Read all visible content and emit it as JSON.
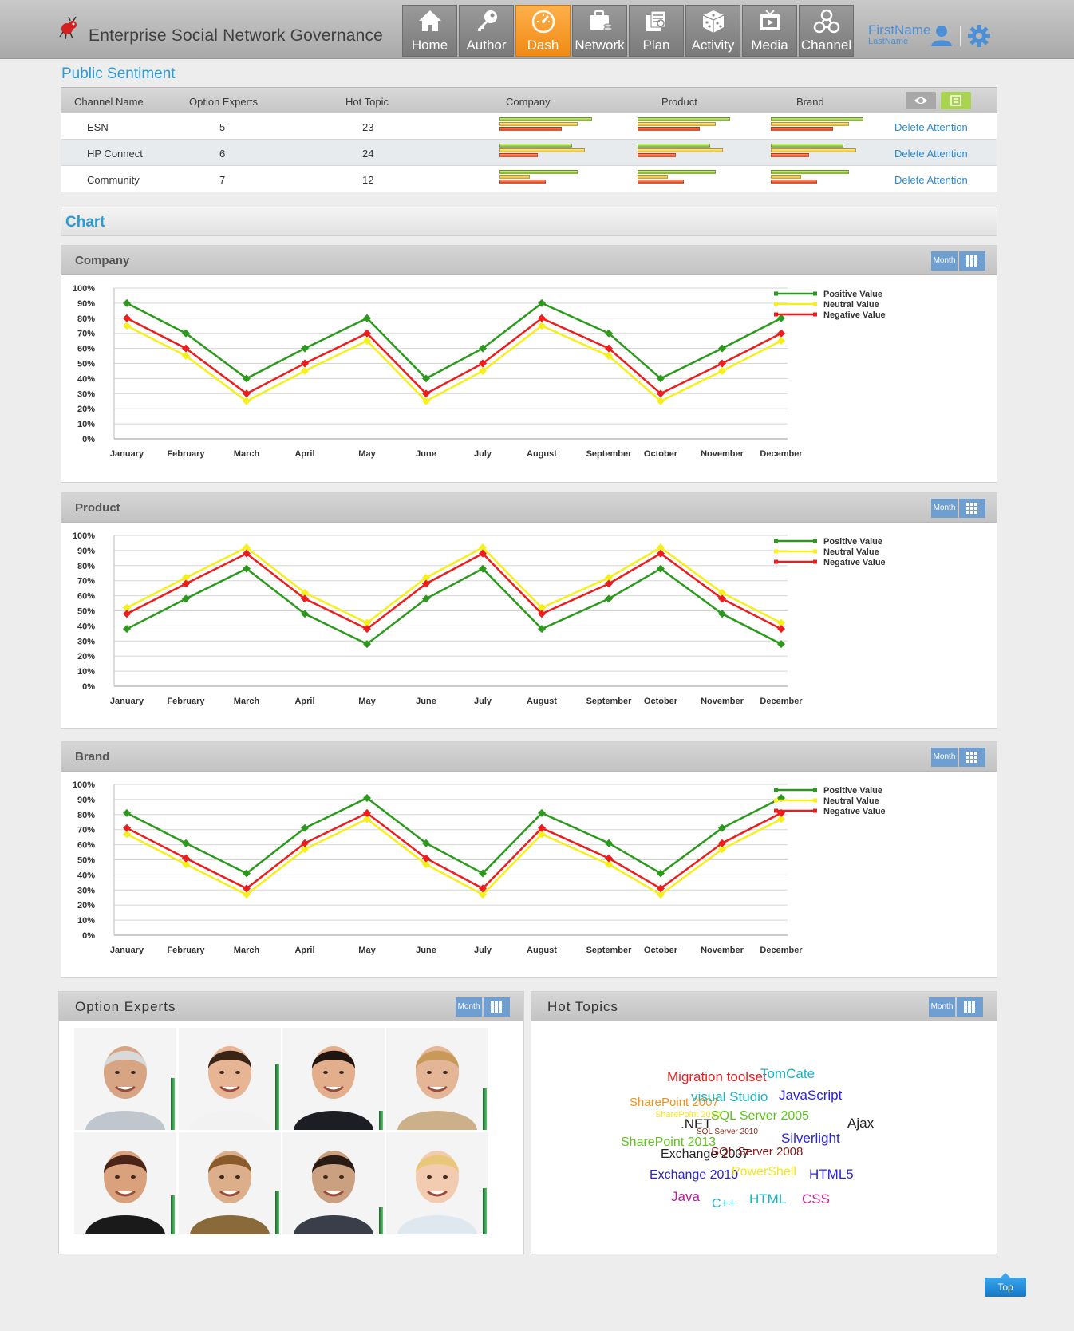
{
  "header": {
    "app_title": "Enterprise Social Network Governance",
    "nav": [
      {
        "label": "Home",
        "icon": "home-icon",
        "active": false
      },
      {
        "label": "Author",
        "icon": "key-icon",
        "active": false
      },
      {
        "label": "Dash",
        "icon": "dashboard-icon",
        "active": true
      },
      {
        "label": "Network",
        "icon": "briefcase-icon",
        "active": false
      },
      {
        "label": "Plan",
        "icon": "plan-icon",
        "active": false
      },
      {
        "label": "Activity",
        "icon": "dice-icon",
        "active": false
      },
      {
        "label": "Media",
        "icon": "tv-icon",
        "active": false
      },
      {
        "label": "Channel",
        "icon": "network-nodes-icon",
        "active": false
      }
    ],
    "user_first": "FirstName",
    "user_last": "LastName"
  },
  "public_sentiment": {
    "title": "Public Sentiment",
    "headers": {
      "channel": "Channel Name",
      "experts": "Option Experts",
      "topic": "Hot Topic",
      "company": "Company",
      "product": "Product",
      "brand": "Brand"
    },
    "rows": [
      {
        "channel": "ESN",
        "experts": "5",
        "topic": "23",
        "action": "Delete Attention",
        "company": [
          0.92,
          0.78,
          0.62
        ],
        "product": [
          0.92,
          0.78,
          0.62
        ],
        "brand": [
          0.92,
          0.78,
          0.62
        ]
      },
      {
        "channel": "HP Connect",
        "experts": "6",
        "topic": "24",
        "action": "Delete Attention",
        "company": [
          0.72,
          0.85,
          0.38
        ],
        "product": [
          0.72,
          0.85,
          0.38
        ],
        "brand": [
          0.72,
          0.85,
          0.38
        ]
      },
      {
        "channel": "Community",
        "experts": "7",
        "topic": "12",
        "action": "Delete Attention",
        "company": [
          0.78,
          0.3,
          0.46
        ],
        "product": [
          0.78,
          0.3,
          0.46
        ],
        "brand": [
          0.78,
          0.3,
          0.46
        ]
      }
    ]
  },
  "chart_section_title": "Chart",
  "month_label": "Month",
  "chart_data": [
    {
      "type": "line",
      "title": "Company",
      "categories": [
        "January",
        "February",
        "March",
        "April",
        "May",
        "June",
        "July",
        "August",
        "September",
        "October",
        "November",
        "December"
      ],
      "ylim": [
        0,
        100
      ],
      "yticks": [
        "0%",
        "10%",
        "20%",
        "30%",
        "40%",
        "50%",
        "60%",
        "70%",
        "80%",
        "90%",
        "100%"
      ],
      "legend_position": "top-right",
      "grid": true,
      "series": [
        {
          "name": "Positive Value",
          "color": "#2b9a1c",
          "values": [
            90,
            70,
            40,
            60,
            80,
            40,
            60,
            90,
            70,
            40,
            60,
            80
          ]
        },
        {
          "name": "Neutral Value",
          "color": "#f5f019",
          "values": [
            75,
            55,
            25,
            45,
            65,
            25,
            45,
            75,
            55,
            25,
            45,
            65
          ]
        },
        {
          "name": "Negative Value",
          "color": "#ee1c1c",
          "values": [
            80,
            60,
            30,
            50,
            70,
            30,
            50,
            80,
            60,
            30,
            50,
            70
          ]
        }
      ]
    },
    {
      "type": "line",
      "title": "Product",
      "categories": [
        "January",
        "February",
        "March",
        "April",
        "May",
        "June",
        "July",
        "August",
        "September",
        "October",
        "November",
        "December"
      ],
      "ylim": [
        0,
        100
      ],
      "yticks": [
        "0%",
        "10%",
        "20%",
        "30%",
        "40%",
        "50%",
        "60%",
        "70%",
        "80%",
        "90%",
        "100%"
      ],
      "legend_position": "top-right",
      "grid": true,
      "series": [
        {
          "name": "Positive Value",
          "color": "#2b9a1c",
          "values": [
            38,
            58,
            78,
            48,
            28,
            58,
            78,
            38,
            58,
            78,
            48,
            28
          ]
        },
        {
          "name": "Neutral Value",
          "color": "#f5f019",
          "values": [
            52,
            72,
            92,
            62,
            42,
            72,
            92,
            52,
            72,
            92,
            62,
            42
          ]
        },
        {
          "name": "Negative Value",
          "color": "#ee1c1c",
          "values": [
            48,
            68,
            88,
            58,
            38,
            68,
            88,
            48,
            68,
            88,
            58,
            38
          ]
        }
      ]
    },
    {
      "type": "line",
      "title": "Brand",
      "categories": [
        "January",
        "February",
        "March",
        "April",
        "May",
        "June",
        "July",
        "August",
        "September",
        "October",
        "November",
        "December"
      ],
      "ylim": [
        0,
        100
      ],
      "yticks": [
        "0%",
        "10%",
        "20%",
        "30%",
        "40%",
        "50%",
        "60%",
        "70%",
        "80%",
        "90%",
        "100%"
      ],
      "legend_position": "top-right",
      "grid": true,
      "series": [
        {
          "name": "Positive Value",
          "color": "#2b9a1c",
          "values": [
            81,
            61,
            41,
            71,
            91,
            61,
            41,
            81,
            61,
            41,
            71,
            91
          ]
        },
        {
          "name": "Neutral Value",
          "color": "#f5f019",
          "values": [
            67,
            47,
            27,
            57,
            77,
            47,
            27,
            67,
            47,
            27,
            57,
            77
          ]
        },
        {
          "name": "Negative Value",
          "color": "#ee1c1c",
          "values": [
            71,
            51,
            31,
            61,
            81,
            51,
            31,
            71,
            51,
            31,
            61,
            81
          ]
        }
      ]
    }
  ],
  "experts": {
    "title": "Option Experts",
    "people": [
      {
        "name": "expert-1",
        "level": 0.65
      },
      {
        "name": "expert-2",
        "level": 0.82
      },
      {
        "name": "expert-3",
        "level": 0.24
      },
      {
        "name": "expert-4",
        "level": 0.52
      },
      {
        "name": "expert-5",
        "level": 0.49
      },
      {
        "name": "expert-6",
        "level": 0.55
      },
      {
        "name": "expert-7",
        "level": 0.34
      },
      {
        "name": "expert-8",
        "level": 0.58
      }
    ]
  },
  "hot_topics": {
    "title": "Hot Topics",
    "words": [
      {
        "text": "Migration toolset",
        "color": "#e81e1e",
        "size": 17
      },
      {
        "text": "TomCate",
        "color": "#18b5c2",
        "size": 17
      },
      {
        "text": "SharePoint 2007",
        "color": "#f2911c",
        "size": 15
      },
      {
        "text": "visual Studio",
        "color": "#18b5c2",
        "size": 17
      },
      {
        "text": "JavaScript",
        "color": "#2a22e0",
        "size": 17
      },
      {
        "text": "SharePoint 2010",
        "color": "#f4e61a",
        "size": 11
      },
      {
        "text": "SQL Server 2005",
        "color": "#5ec41a",
        "size": 16
      },
      {
        "text": ".NET",
        "color": "#222222",
        "size": 17
      },
      {
        "text": "Ajax",
        "color": "#222222",
        "size": 17
      },
      {
        "text": "SQL Server 2010",
        "color": "#8a2a1a",
        "size": 10
      },
      {
        "text": "Silverlight",
        "color": "#2a22e0",
        "size": 17
      },
      {
        "text": "SharePoint 2013",
        "color": "#5ec41a",
        "size": 16
      },
      {
        "text": "Exchange 2007",
        "color": "#222222",
        "size": 16
      },
      {
        "text": "SQL Server 2008",
        "color": "#8a1a1a",
        "size": 15
      },
      {
        "text": "Exchange 2010",
        "color": "#2a22e0",
        "size": 16
      },
      {
        "text": "PowerShell",
        "color": "#f4e61a",
        "size": 16
      },
      {
        "text": "HTML5",
        "color": "#2a22e0",
        "size": 17
      },
      {
        "text": "Java",
        "color": "#b81e9a",
        "size": 17
      },
      {
        "text": "C++",
        "color": "#18b5c2",
        "size": 16
      },
      {
        "text": "HTML",
        "color": "#18b5c2",
        "size": 17
      },
      {
        "text": "CSS",
        "color": "#d02aa0",
        "size": 17
      }
    ]
  },
  "top_button": "Top"
}
